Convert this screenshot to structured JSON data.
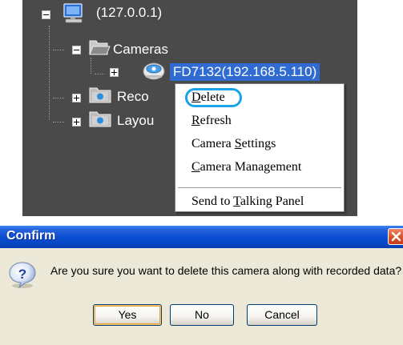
{
  "tree": {
    "root_label": "(127.0.0.1)",
    "cameras_label": "Cameras",
    "camera_item_label": "FD7132(192.168.5.110)",
    "recordings_label": "Reco",
    "layouts_label": "Layou"
  },
  "context_menu": {
    "items": [
      {
        "pre": "",
        "ul": "D",
        "post": "elete"
      },
      {
        "pre": "",
        "ul": "R",
        "post": "efresh"
      },
      {
        "pre": "Camera ",
        "ul": "S",
        "post": "ettings"
      },
      {
        "pre": "",
        "ul": "C",
        "post": "amera Management"
      },
      {
        "pre": "Send to ",
        "ul": "T",
        "post": "alking Panel"
      }
    ],
    "highlighted_item": "Delete"
  },
  "dialog": {
    "title": "Confirm",
    "message": "Are you sure you want to delete this camera along with recorded data?",
    "buttons": {
      "yes": "Yes",
      "no": "No",
      "cancel": "Cancel"
    }
  },
  "colors": {
    "tree_background": "#4a4a4a",
    "selection": "#2f6bd1",
    "highlight_circle": "#1aa3e8",
    "titlebar": "#0b4fd2",
    "dialog_background": "#ece9d8"
  },
  "icons": [
    "computer-icon",
    "folder-open-icon",
    "camera-icon",
    "folder-icon",
    "question-icon",
    "close-icon"
  ]
}
